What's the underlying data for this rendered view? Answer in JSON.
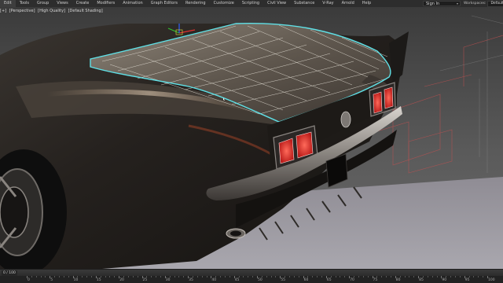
{
  "menu": {
    "items": [
      "Edit",
      "Tools",
      "Group",
      "Views",
      "Create",
      "Modifiers",
      "Animation",
      "Graph Editors",
      "Rendering",
      "Customize",
      "Scripting",
      "Civil View",
      "Substance",
      "V-Ray",
      "Arnold",
      "Help"
    ],
    "signin_label": "Sign In",
    "workspace_label": "Workspaces:",
    "workspace_value": "Default"
  },
  "viewport": {
    "label_parts": [
      "[+]",
      "[Perspective]",
      "[High Quality]",
      "[Default Shading]"
    ],
    "background_color": "#505050"
  },
  "timeline": {
    "frame_counter": "0 / 100",
    "ticks": [
      "0",
      "5",
      "10",
      "15",
      "20",
      "25",
      "30",
      "35",
      "40",
      "45",
      "50",
      "55",
      "60",
      "65",
      "70",
      "75",
      "80",
      "85",
      "90",
      "95",
      "100"
    ]
  },
  "colors": {
    "selection_outline": "#5fe0e6",
    "grid_wire": "#e8e4da",
    "tail_light": "#ff3333",
    "car_body": "#2a2624"
  }
}
